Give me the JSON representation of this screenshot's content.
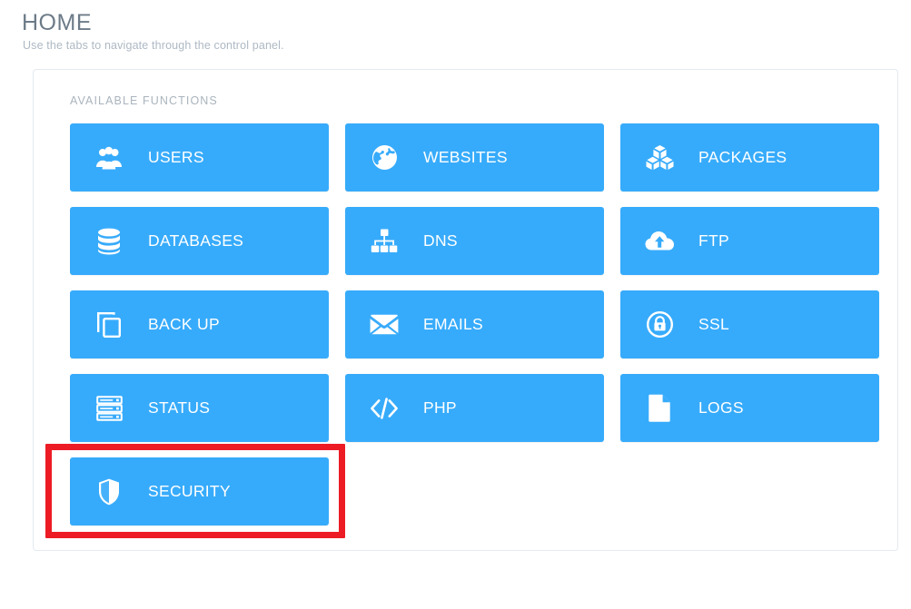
{
  "header": {
    "title": "HOME",
    "subtitle": "Use the tabs to navigate through the control panel."
  },
  "panel": {
    "label": "AVAILABLE FUNCTIONS",
    "tiles": [
      {
        "label": "USERS",
        "icon": "users-icon"
      },
      {
        "label": "WEBSITES",
        "icon": "globe-icon"
      },
      {
        "label": "PACKAGES",
        "icon": "boxes-icon"
      },
      {
        "label": "DATABASES",
        "icon": "database-icon"
      },
      {
        "label": "DNS",
        "icon": "sitemap-icon"
      },
      {
        "label": "FTP",
        "icon": "cloud-upload-icon"
      },
      {
        "label": "BACK UP",
        "icon": "copy-icon"
      },
      {
        "label": "EMAILS",
        "icon": "envelope-icon"
      },
      {
        "label": "SSL",
        "icon": "lock-circle-icon"
      },
      {
        "label": "STATUS",
        "icon": "server-icon"
      },
      {
        "label": "PHP",
        "icon": "code-icon"
      },
      {
        "label": "LOGS",
        "icon": "file-icon"
      },
      {
        "label": "SECURITY",
        "icon": "shield-icon"
      }
    ]
  },
  "annotation": {
    "target": "SECURITY",
    "color": "#ed1c24"
  },
  "colors": {
    "tile_blue": "#37abfb",
    "tile_text": "#ffffff",
    "title_grey": "#6d7b88",
    "subtitle_grey": "#aeb9c4",
    "panel_border": "#e3eaf0",
    "label_grey": "#aab4bd",
    "page_background": "#ffffff"
  }
}
